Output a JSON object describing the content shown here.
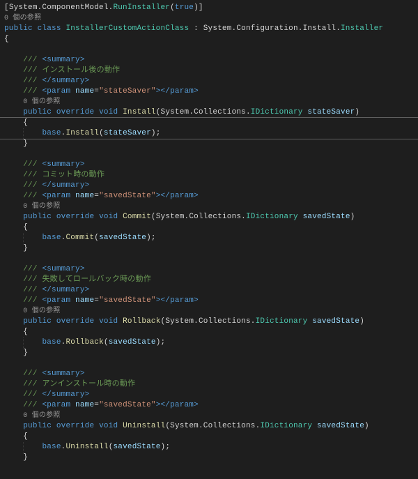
{
  "code": {
    "attribute_ns": "System.ComponentModel",
    "attribute_name": "RunInstaller",
    "attribute_arg": "true",
    "codelens": "0 個の参照",
    "class_kw_public": "public",
    "class_kw_class": "class",
    "class_name": "InstallerCustomActionClass",
    "class_base_ns1": "System",
    "class_base_ns2": "Configuration",
    "class_base_ns3": "Install",
    "class_base_type": "Installer",
    "brace_open": "{",
    "brace_close": "}",
    "methods": [
      {
        "name": "Install",
        "summary": "インストール後の動作",
        "param_name": "stateSaver",
        "callparam": "stateSaver",
        "call_method": "Install"
      },
      {
        "name": "Commit",
        "summary": "コミット時の動作",
        "param_name": "savedState",
        "callparam": "savedState",
        "call_method": "Commit"
      },
      {
        "name": "Rollback",
        "summary": "失敗してロールバック時の動作",
        "param_name": "savedState",
        "callparam": "savedState",
        "call_method": "Rollback"
      },
      {
        "name": "Uninstall",
        "summary": "アンインストール時の動作",
        "param_name": "savedState",
        "callparam": "savedState",
        "call_method": "Uninstall"
      }
    ],
    "xml": {
      "summary_open": "<summary>",
      "summary_close": "</summary>",
      "doc_slashes": "///",
      "param_open_a": "<param ",
      "param_name_attr": "name",
      "param_open_b": "=",
      "param_close_tag": "></param>"
    },
    "common": {
      "kw_public": "public",
      "kw_override": "override",
      "kw_void": "void",
      "kw_base": "base",
      "param_type_ns1": "System",
      "param_type_ns2": "Collections",
      "param_type": "IDictionary"
    }
  }
}
